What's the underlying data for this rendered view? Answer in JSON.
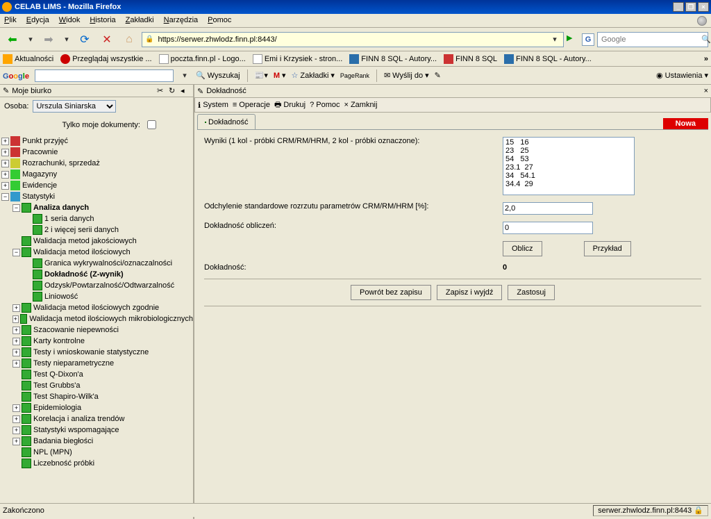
{
  "window": {
    "title": "CELAB LIMS - Mozilla Firefox"
  },
  "menu": {
    "plik": "Plik",
    "edycja": "Edycja",
    "widok": "Widok",
    "historia": "Historia",
    "zakladki": "Zakładki",
    "narzedzia": "Narzędzia",
    "pomoc": "Pomoc"
  },
  "url": {
    "value": "https://serwer.zhwlodz.finn.pl:8443/"
  },
  "search": {
    "placeholder": "Google"
  },
  "bookmarks": {
    "b1": "Aktualności",
    "b2": "Przeglądaj wszystkie ...",
    "b3": "poczta.finn.pl - Logo...",
    "b4": "Emi i Krzysiek - stron...",
    "b5": "FINN 8 SQL - Autory...",
    "b6": "FINN 8 SQL",
    "b7": "FINN 8 SQL - Autory..."
  },
  "googlebar": {
    "wyszukaj": "Wyszukaj",
    "zakladki": "Zakładki",
    "pagerank": "PageRank",
    "wyslij": "Wyślij do",
    "ustawienia": "Ustawienia"
  },
  "sidebar": {
    "title": "Moje biurko",
    "osoba_label": "Osoba:",
    "osoba_value": "Urszula Siniarska",
    "tylko": "Tylko moje dokumenty:",
    "nodes": {
      "n0": "Punkt przyjęć",
      "n1": "Pracownie",
      "n2": "Rozrachunki, sprzedaż",
      "n3": "Magazyny",
      "n4": "Ewidencje",
      "n5": "Statystyki",
      "n5a": "Analiza danych",
      "n5a1": "1 seria danych",
      "n5a2": "2 i więcej serii danych",
      "n5b": "Walidacja metod jakościowych",
      "n5c": "Walidacja metod ilościowych",
      "n5c1": "Granica wykrywalności/oznaczalności",
      "n5c2": "Dokładność (Z-wynik)",
      "n5c3": "Odzysk/Powtarzalność/Odtwarzalność",
      "n5c4": "Liniowość",
      "n5d": "Walidacja metod ilościowych zgodnie",
      "n5e": "Walidacja metod ilościowych mikrobiologicznych",
      "n5f": "Szacowanie niepewności",
      "n5g": "Karty kontrolne",
      "n5h": "Testy i wnioskowanie statystyczne",
      "n5i": "Testy nieparametryczne",
      "n5j": "Test Q-Dixon'a",
      "n5k": "Test Grubbs'a",
      "n5l": "Test Shapiro-Wilk'a",
      "n5m": "Epidemiologia",
      "n5n": "Korelacja i analiza trendów",
      "n5o": "Statystyki wspomagające",
      "n5p": "Badania biegłości",
      "n5q": "NPL (MPN)",
      "n5r": "Liczebność próbki"
    }
  },
  "pane": {
    "title": "Dokładność",
    "toolbar": {
      "system": "System",
      "operacje": "Operacje",
      "drukuj": "Drukuj",
      "pomoc": "Pomoc",
      "zamknij": "Zamknij"
    },
    "tab": "Dokładność",
    "nowa": "Nowa",
    "form": {
      "wyniki_label": "Wyniki (1 kol - próbki CRM/RM/HRM, 2 kol - próbki oznaczone):",
      "list": [
        "15   16",
        "23   25",
        "54   53",
        "23.1  27",
        "34   54.1",
        "34.4  29"
      ],
      "odchylenie_label": "Odchylenie standardowe rozrzutu parametrów CRM/RM/HRM [%]:",
      "odchylenie_value": "2,0",
      "dokobl_label": "Dokładność obliczeń:",
      "dokobl_value": "0",
      "oblicz": "Oblicz",
      "przyklad": "Przykład",
      "dok_label": "Dokładność:",
      "dok_value": "0",
      "powrot": "Powrót bez zapisu",
      "zapisz": "Zapisz i wyjdź",
      "zastosuj": "Zastosuj"
    }
  },
  "status": {
    "left": "Zakończono",
    "right": "serwer.zhwlodz.finn.pl:8443"
  }
}
